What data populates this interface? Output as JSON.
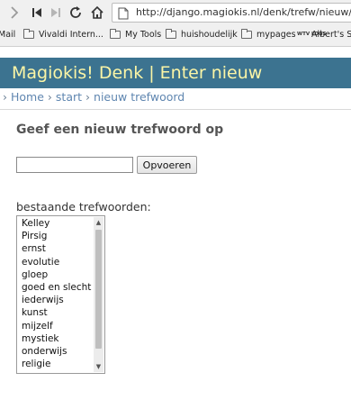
{
  "browser": {
    "url": "http://django.magiokis.nl/denk/trefw/nieuw/",
    "icons": [
      "forward-icon",
      "first-page-icon",
      "next-page-icon",
      "reload-icon",
      "home-icon",
      "page-info-icon"
    ]
  },
  "bookmarks": [
    {
      "label": "Mail",
      "icon": "none"
    },
    {
      "label": "Vivaldi Intern...",
      "icon": "folder-icon"
    },
    {
      "label": "My Tools",
      "icon": "folder-icon"
    },
    {
      "label": "huishoudelijk",
      "icon": "folder-icon"
    },
    {
      "label": "mypages",
      "icon": "folder-icon"
    },
    {
      "label": "Albert's S",
      "icon": "wtv-logo",
      "logo_text": "WTV LOGS"
    }
  ],
  "site": {
    "title": "Magiokis! Denk | Enter nieuw",
    "header_color": "#3c7390",
    "title_color": "#fbf5a6"
  },
  "breadcrumb": {
    "separator": "›",
    "items": [
      "Home",
      "start",
      "nieuw trefwoord"
    ]
  },
  "form": {
    "heading": "Geef een nieuw trefwoord op",
    "input_value": "",
    "submit_label": "Opvoeren"
  },
  "keywords": {
    "label": "bestaande trefwoorden:",
    "items": [
      "Kelley",
      "Pirsig",
      "ernst",
      "evolutie",
      "gloep",
      "goed en slecht",
      "iederwijs",
      "kunst",
      "mijzelf",
      "mystiek",
      "onderwijs",
      "religie"
    ]
  }
}
